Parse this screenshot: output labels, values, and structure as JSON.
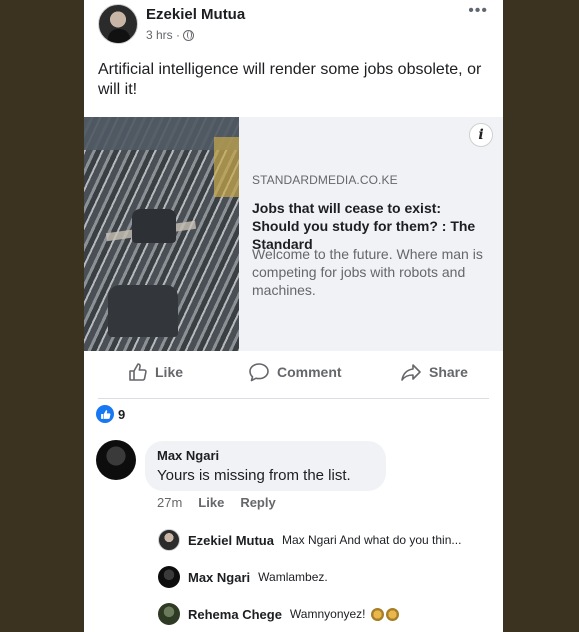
{
  "post": {
    "author": "Ezekiel Mutua",
    "time": "3 hrs ·",
    "more_glyph": "•••",
    "text": "Artificial intelligence will render some jobs obsolete, or will it!"
  },
  "link": {
    "info_glyph": "i",
    "source": "STANDARDMEDIA.CO.KE",
    "title": "Jobs that will cease to exist: Should you study for them? : The Standard",
    "description": "Welcome to the future. Where man is competing for jobs with robots and machines."
  },
  "actions": {
    "like": "Like",
    "comment": "Comment",
    "share": "Share"
  },
  "reactions": {
    "count": "9"
  },
  "comment": {
    "name": "Max Ngari",
    "text": "Yours is missing from the list.",
    "time": "27m",
    "like": "Like",
    "reply": "Reply"
  },
  "replies": [
    {
      "name": "Ezekiel Mutua",
      "text": "Max Ngari And what do you thin..."
    },
    {
      "name": "Max Ngari",
      "text": "Wamlambez."
    },
    {
      "name": "Rehema Chege",
      "text": "Wamnyonyez!"
    }
  ],
  "colors": {
    "background": "#3b3320",
    "accent": "#1877f2",
    "secondary_text": "#65676b",
    "link_card_bg": "#f0f2f5"
  },
  "icons": [
    "globe-icon",
    "more-options-icon",
    "info-icon",
    "like-icon",
    "comment-icon",
    "share-icon",
    "like-reaction-icon",
    "emoji-icon"
  ]
}
